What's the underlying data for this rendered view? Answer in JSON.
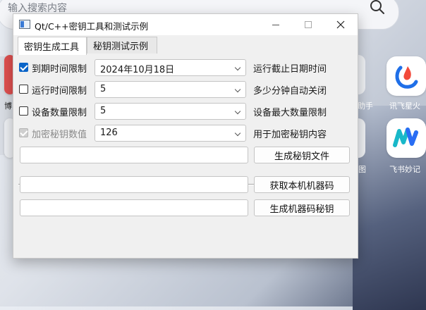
{
  "desktop": {
    "search_placeholder": "输入搜索内容",
    "apps": [
      {
        "label": "讯飞星火",
        "icon": "xunfei-spark-icon"
      },
      {
        "label": "飞书妙记",
        "icon": "feishu-miaoji-icon"
      }
    ],
    "partial_labels": [
      "博",
      "助手",
      "图"
    ]
  },
  "window": {
    "title": "Qt/C++密钥工具和测试示例",
    "tabs": [
      {
        "label": "密钥生成工具",
        "active": true
      },
      {
        "label": "秘钥测试示例",
        "active": false
      }
    ],
    "rows": [
      {
        "check_label": "到期时间限制",
        "checked": true,
        "enabled": true,
        "value": "2024年10月18日",
        "desc": "运行截止日期时间"
      },
      {
        "check_label": "运行时间限制",
        "checked": false,
        "enabled": true,
        "value": "5",
        "desc": "多少分钟自动关闭"
      },
      {
        "check_label": "设备数量限制",
        "checked": false,
        "enabled": true,
        "value": "5",
        "desc": "设备最大数量限制"
      },
      {
        "check_label": "加密秘钥数值",
        "checked": true,
        "enabled": false,
        "value": "126",
        "desc": "用于加密秘钥内容"
      }
    ],
    "actions": {
      "generate_key_file": "生成秘钥文件",
      "get_machine_code": "获取本机机器码",
      "generate_machine_key": "生成机器码秘钥"
    },
    "inputs": {
      "key_file": "",
      "machine_code": "",
      "machine_key": ""
    }
  }
}
